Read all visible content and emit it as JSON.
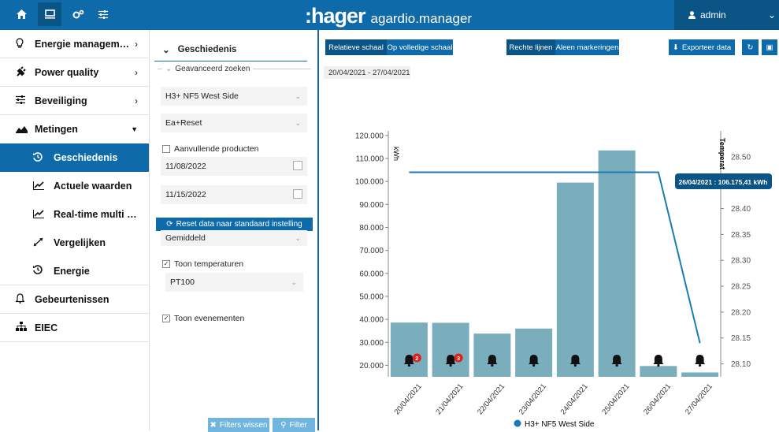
{
  "header": {
    "brand_logo": ":hager",
    "brand_product": "agardio.manager",
    "user": "admin",
    "nav_icons": [
      "home-icon",
      "monitor-icon",
      "gears-icon",
      "sliders-icon"
    ]
  },
  "sidebar": {
    "items": [
      {
        "label": "Energie managem…",
        "icon": "lightbulb-icon"
      },
      {
        "label": "Power quality",
        "icon": "plug-icon"
      },
      {
        "label": "Beveiliging",
        "icon": "sliders-icon"
      },
      {
        "label": "Metingen",
        "icon": "area-chart-icon"
      }
    ],
    "subitems": [
      {
        "label": "Geschiedenis",
        "icon": "history-icon"
      },
      {
        "label": "Actuele waarden",
        "icon": "line-chart-icon"
      },
      {
        "label": "Real-time multi …",
        "icon": "line-chart-icon"
      },
      {
        "label": "Vergelijken",
        "icon": "compare-icon"
      },
      {
        "label": "Energie",
        "icon": "history-icon"
      }
    ],
    "bottom": [
      {
        "label": "Gebeurtenissen",
        "icon": "bell-icon"
      },
      {
        "label": "EIEC",
        "icon": "sitemap-icon"
      }
    ]
  },
  "filter": {
    "title": "Geschiedenis",
    "advanced": "Geavanceerd zoeken",
    "device": "H3+ NF5 West Side",
    "measurement": "Ea+Reset",
    "extra_products": "Aanvullende producten",
    "date_from": "11/08/2022",
    "date_to": "11/15/2022",
    "reset_label": "Reset data naar standaard instelling",
    "aggregation": "Gemiddeld",
    "show_temperatures": "Toon temperaturen",
    "sensor": "PT100",
    "show_events": "Toon evenementen",
    "clear_label": "Filters wissen",
    "filter_label": "Filter"
  },
  "toolbar": {
    "relative": "Relatieve schaal",
    "full_scale": "Op volledige schaal",
    "straight": "Rechte lijnen",
    "markers": "Aleen markeringen",
    "export": "Exporteer data"
  },
  "date_range": "20/04/2021 - 27/04/2021",
  "colors": {
    "primary": "#0e6aa8",
    "bar": "#7aaebd",
    "line": "#1b7bb8",
    "badge": "#e0201b"
  },
  "chart_data": {
    "type": "bar",
    "categories": [
      "20/04/2021",
      "21/04/2021",
      "22/04/2021",
      "23/04/2021",
      "24/04/2021",
      "25/04/2021",
      "26/04/2021",
      "27/04/2021"
    ],
    "series": [
      {
        "name": "H3+ NF5 West Side",
        "values": [
          38600,
          38500,
          33800,
          36000,
          99500,
          113500,
          19700,
          16900
        ]
      }
    ],
    "temperature_line": [
      28.47,
      28.47,
      28.47,
      28.47,
      28.47,
      28.47,
      28.47,
      28.14
    ],
    "y_left": {
      "label": "kWh",
      "min": 15000,
      "max": 122000,
      "ticks": [
        "20.000",
        "30.000",
        "40.000",
        "50.000",
        "60.000",
        "70.000",
        "80.000",
        "90.000",
        "100.000",
        "110.000",
        "120.000"
      ]
    },
    "y_right": {
      "label": "Temperat",
      "min": 28.075,
      "max": 28.55,
      "ticks": [
        "28.10",
        "28.15",
        "28.20",
        "28.25",
        "28.30",
        "28.35",
        "28.40",
        "28.45",
        "28.50"
      ]
    },
    "event_badges": [
      "2",
      "3",
      "",
      "",
      "",
      "",
      "",
      ""
    ],
    "tooltip": "26/04/2021 : 106.175,41 kWh",
    "legend_position": "bottom"
  }
}
